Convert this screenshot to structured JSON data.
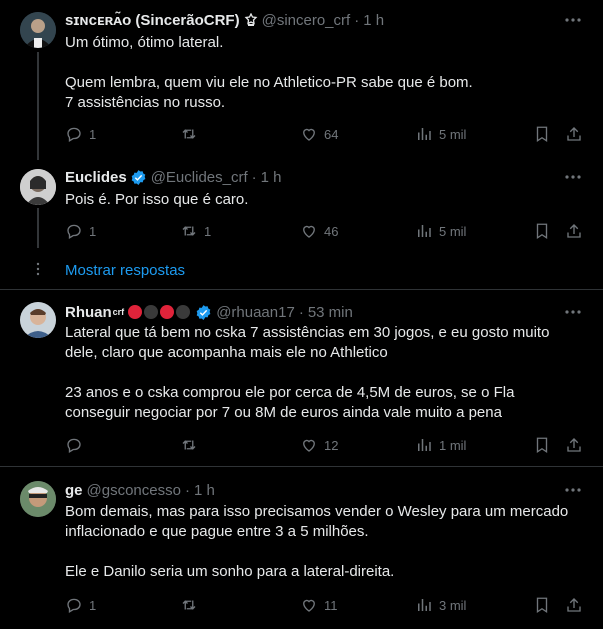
{
  "tweets": [
    {
      "name": "ѕɪɴᴄᴇʀᴀ̃ᴏ (SincerãoCRF)",
      "handle": "@sincero_crf",
      "time": "1 h",
      "text": "Um ótimo, ótimo lateral.\n\nQuem lembra, quem viu ele no Athletico-PR sabe que é bom.\n7 assistências no russo.",
      "replies": "1",
      "retweets": "",
      "likes": "64",
      "views": "5 mil"
    },
    {
      "name": "Euclides",
      "handle": "@Euclides_crf",
      "time": "1 h",
      "text": "Pois é. Por isso que é caro.",
      "replies": "1",
      "retweets": "1",
      "likes": "46",
      "views": "5 mil"
    },
    {
      "name": "Rhuan",
      "name_sup": "crf",
      "handle": "@rhuaan17",
      "time": "53 min",
      "text": "Lateral que tá bem no cska 7 assistências em 30 jogos, e eu gosto muito\ndele, claro que acompanha mais ele no Athletico\n\n23 anos e o cska comprou ele por cerca de 4,5M de euros, se o Fla\nconseguir negociar por 7 ou 8M de euros ainda vale muito a pena",
      "replies": "",
      "retweets": "",
      "likes": "12",
      "views": "1 mil"
    },
    {
      "name": "ge",
      "handle": "@gsconcesso",
      "time": "1 h",
      "text": "Bom demais, mas para isso precisamos vender o Wesley para um mercado\ninflacionado e que pague entre 3 a 5 milhões.\n\nEle e Danilo seria um sonho para a lateral-direita.",
      "replies": "1",
      "retweets": "",
      "likes": "11",
      "views": "3 mil"
    }
  ],
  "show_replies": "Mostrar respostas",
  "separator": "·",
  "colors": {
    "background": "#000000",
    "text": "#e7e9ea",
    "muted": "#71767b",
    "link": "#1d9bf0",
    "verified": "#1d9bf0",
    "divider": "#2f3336"
  },
  "icons": [
    "reply-icon",
    "retweet-icon",
    "like-icon",
    "views-icon",
    "bookmark-icon",
    "share-icon",
    "more-icon",
    "verified-icon"
  ]
}
